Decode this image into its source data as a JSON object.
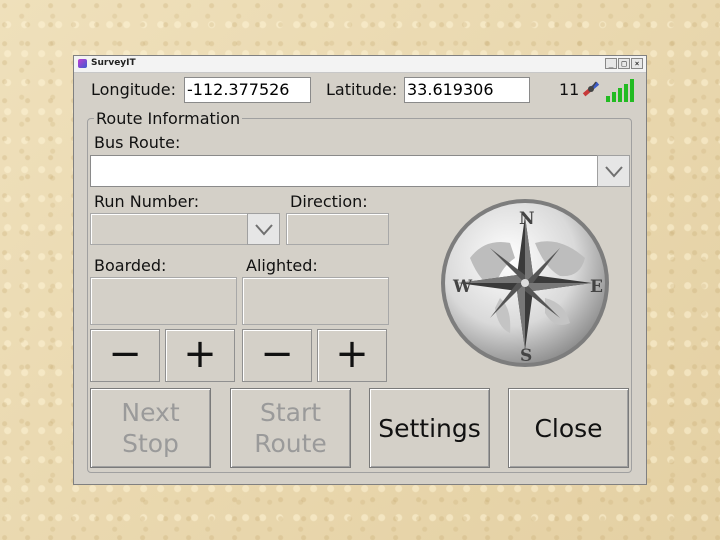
{
  "window": {
    "title": "SurveyIT",
    "controls": [
      "_",
      "□",
      "×"
    ]
  },
  "gps": {
    "longitude_label": "Longitude:",
    "longitude_value": "-112.377526",
    "latitude_label": "Latitude:",
    "latitude_value": "33.619306",
    "satellite_count": "11",
    "satellite_icon": "satellite-icon",
    "signal_icon": "signal-strength-icon",
    "signal_color": "#22bb22"
  },
  "route": {
    "group_title": "Route Information",
    "bus_route_label": "Bus Route:",
    "bus_route_value": "",
    "run_number_label": "Run Number:",
    "direction_label": "Direction:",
    "boarded_label": "Boarded:",
    "alighted_label": "Alighted:"
  },
  "steppers": {
    "minus": "−",
    "plus": "+"
  },
  "compass": {
    "icon": "compass-icon",
    "north": "N",
    "south": "S",
    "east": "E",
    "west": "W"
  },
  "buttons": {
    "next_stop": "Next Stop",
    "start_route": "Start Route",
    "settings": "Settings",
    "close": "Close"
  }
}
